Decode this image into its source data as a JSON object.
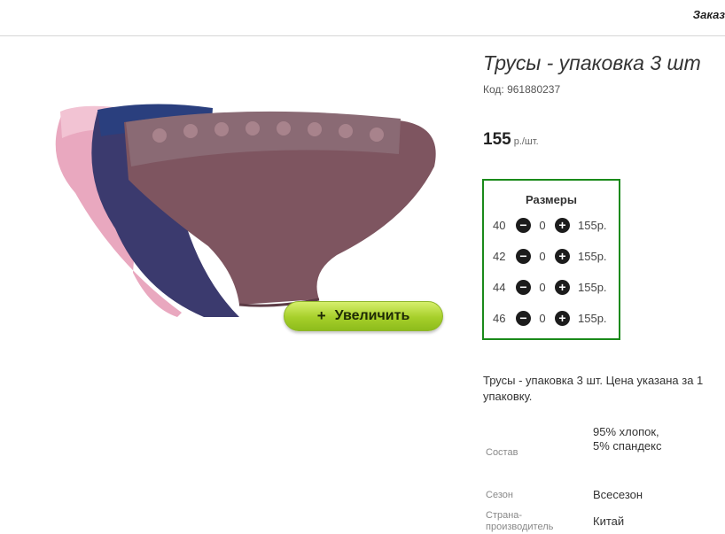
{
  "header": {
    "order_link": "Заказ"
  },
  "product": {
    "title": "Трусы - упаковка 3 шт",
    "sku": "Код: 961880237",
    "price": "155",
    "price_unit": "р./шт.",
    "zoom_label": "Увеличить",
    "zoom_icon": "plus-icon"
  },
  "sizes": {
    "title": "Размеры",
    "rows": [
      {
        "size": "40",
        "qty": "0",
        "price": "155р."
      },
      {
        "size": "42",
        "qty": "0",
        "price": "155р."
      },
      {
        "size": "44",
        "qty": "0",
        "price": "155р."
      },
      {
        "size": "46",
        "qty": "0",
        "price": "155р."
      }
    ]
  },
  "description": "Трусы - упаковка 3 шт. Цена указана за 1 упаковку.",
  "attributes": [
    {
      "label": "Состав",
      "value": "95% хлопок, 5% спандекс"
    },
    {
      "label": "Сезон",
      "value": "Всесезон"
    },
    {
      "label": "Страна-производитель",
      "value": "Китай"
    }
  ],
  "colors": {
    "accent_green": "#1a8a1a",
    "button_lime": "#a6cf2a"
  }
}
